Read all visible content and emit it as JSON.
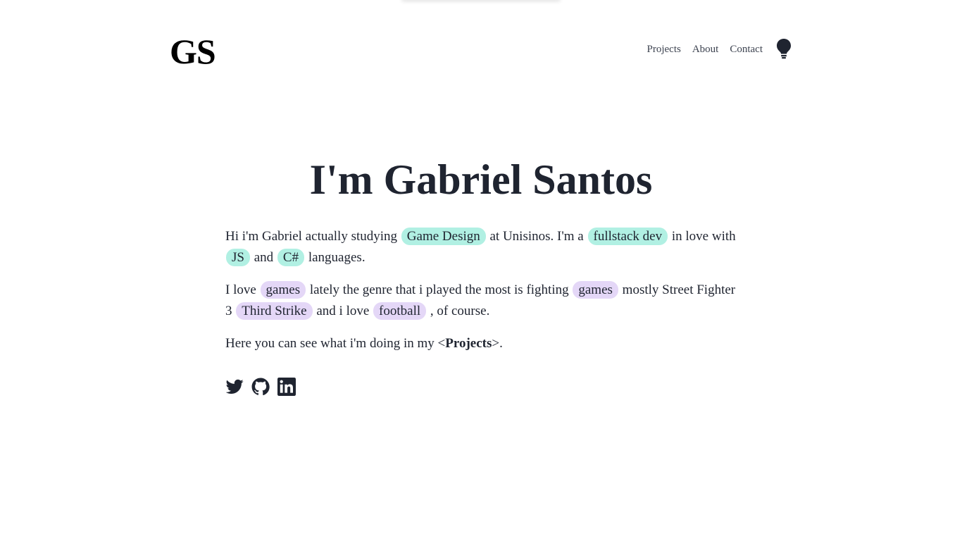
{
  "header": {
    "logo": "GS",
    "nav": {
      "projects": "Projects",
      "about": "About",
      "contact": "Contact"
    },
    "theme_toggle_icon": "lightbulb-icon"
  },
  "hero": {
    "title": "I'm Gabriel Santos"
  },
  "intro": {
    "p1_t1": "Hi i'm Gabriel actually studying ",
    "p1_tag1": "Game Design",
    "p1_t2": " at Unisinos. I'm a ",
    "p1_tag2": "fullstack dev",
    "p1_t3": " in love with ",
    "p1_tag3": "JS",
    "p1_t4": " and ",
    "p1_tag4": "C#",
    "p1_t5": " languages.",
    "p2_t1": "I love ",
    "p2_tag1": "games",
    "p2_t2": " lately the genre that i played the most is fighting ",
    "p2_tag2": "games",
    "p2_t3": " mostly Street Fighter 3 ",
    "p2_tag3": "Third Strike",
    "p2_t4": " and i love ",
    "p2_tag4": "football",
    "p2_t5": " , of course.",
    "p3_t1": "Here you can see what i'm doing in my <",
    "p3_link": "Projects",
    "p3_t2": ">."
  },
  "socials": {
    "twitter": "twitter-icon",
    "github": "github-icon",
    "linkedin": "linkedin-icon"
  },
  "colors": {
    "tag_teal": "#b1f0e3",
    "tag_purple": "#e4d7f7",
    "text": "#1f2430"
  }
}
